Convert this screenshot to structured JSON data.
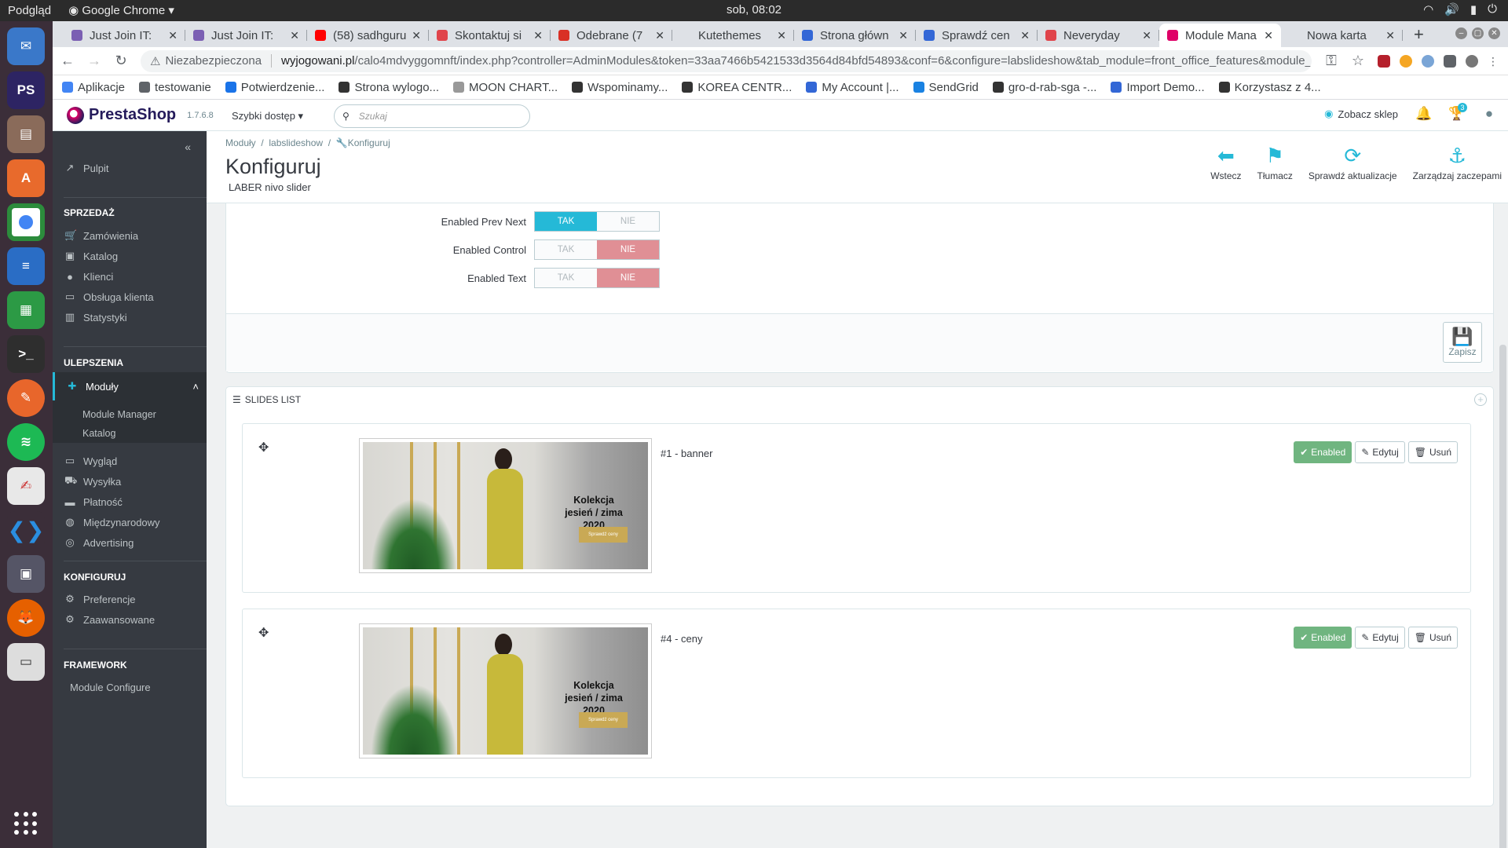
{
  "os": {
    "app_label": "Podgląd",
    "browser_label": "Google Chrome",
    "clock": "sob, 08:02"
  },
  "tabs": [
    {
      "title": "Just Join IT: ",
      "color": "#7b5fb3"
    },
    {
      "title": "Just Join IT: ",
      "color": "#7b5fb3"
    },
    {
      "title": "(58) sadhguru",
      "color": "#ff0000"
    },
    {
      "title": "Skontaktuj si",
      "color": "#e0444b"
    },
    {
      "title": "Odebrane (7",
      "color": "#d93025"
    },
    {
      "title": "Kutethemes",
      "color": "#dee1e6"
    },
    {
      "title": "Strona główn",
      "color": "#3367d6"
    },
    {
      "title": "Sprawdź cen",
      "color": "#3367d6"
    },
    {
      "title": "Neveryday",
      "color": "#e0444b"
    },
    {
      "title": "Module Mana",
      "color": "#df0067",
      "active": true
    },
    {
      "title": "Nowa karta",
      "color": "#dee1e6"
    }
  ],
  "address": {
    "security": "Niezabezpieczona",
    "host": "wyjogowani.pl",
    "path": "/calo4mdvyggomnft/index.php?controller=AdminModules&token=33aa7466b5421533d3564d84bfd54893&conf=6&configure=labslideshow&tab_module=front_office_features&module_na..."
  },
  "bookmarks": [
    {
      "label": "Aplikacje",
      "color": "#4285f4"
    },
    {
      "label": "testowanie",
      "color": "#5f6368"
    },
    {
      "label": "Potwierdzenie...",
      "color": "#1a73e8"
    },
    {
      "label": "Strona wylogo...",
      "color": "#333"
    },
    {
      "label": "MOON CHART...",
      "color": "#999"
    },
    {
      "label": "Wspominamy...",
      "color": "#333"
    },
    {
      "label": "KOREA CENTR...",
      "color": "#333"
    },
    {
      "label": "My Account |...",
      "color": "#3367d6"
    },
    {
      "label": "SendGrid",
      "color": "#1a82e2"
    },
    {
      "label": "gro-d-rab-sga -...",
      "color": "#333"
    },
    {
      "label": "Import Demo...",
      "color": "#3367d6"
    },
    {
      "label": "Korzystasz z 4...",
      "color": "#333"
    }
  ],
  "header": {
    "brand": "PrestaShop",
    "version": "1.7.6.8",
    "quick_access": "Szybki dostęp",
    "search_placeholder": "Szukaj",
    "view_shop": "Zobacz sklep",
    "orders_badge": "3"
  },
  "sidebar": {
    "dashboard": "Pulpit",
    "sections": {
      "sell": "SPRZEDAŻ",
      "improve": "ULEPSZENIA",
      "configure": "KONFIGURUJ",
      "framework": "FRAMEWORK"
    },
    "sell_items": [
      "Zamówienia",
      "Katalog",
      "Klienci",
      "Obsługa klienta",
      "Statystyki"
    ],
    "modules": "Moduły",
    "module_subs": [
      "Module Manager",
      "Katalog"
    ],
    "improve_items": [
      "Wygląd",
      "Wysyłka",
      "Płatność",
      "Międzynarodowy",
      "Advertising"
    ],
    "configure_items": [
      "Preferencje",
      "Zaawansowane"
    ],
    "framework_items": [
      "Module Configure"
    ]
  },
  "toolbar": {
    "breadcrumb": [
      "Moduły",
      "labslideshow",
      "Konfiguruj"
    ],
    "title": "Konfiguruj",
    "subtitle": "LABER nivo slider",
    "buttons": [
      "Wstecz",
      "Tłumacz",
      "Sprawdź aktualizacje",
      "Zarządzaj zaczepami"
    ]
  },
  "settings": {
    "yes": "TAK",
    "no": "NIE",
    "rows": [
      {
        "label": "Enabled Prev Next",
        "value": true
      },
      {
        "label": "Enabled Control",
        "value": false
      },
      {
        "label": "Enabled Text",
        "value": false
      }
    ],
    "save": "Zapisz"
  },
  "slides": {
    "heading": "SLIDES LIST",
    "image_text": "Kolekcja jesień / zima 2020",
    "image_cta": "Sprawdź ceny",
    "status": "Enabled",
    "edit": "Edytuj",
    "delete": "Usuń",
    "items": [
      "#1 - banner",
      "#4 - ceny"
    ]
  }
}
